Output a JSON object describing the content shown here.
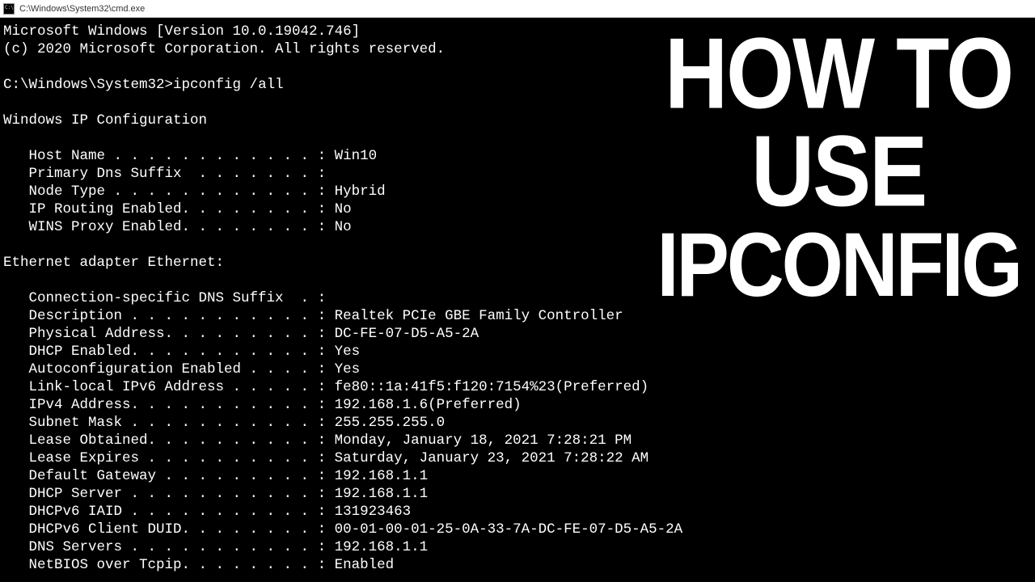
{
  "titlebar": {
    "path": "C:\\Windows\\System32\\cmd.exe"
  },
  "header": {
    "version_line": "Microsoft Windows [Version 10.0.19042.746]",
    "copyright_line": "(c) 2020 Microsoft Corporation. All rights reserved."
  },
  "prompt": {
    "path": "C:\\Windows\\System32>",
    "command": "ipconfig /all"
  },
  "ipconfig": {
    "heading": "Windows IP Configuration",
    "host_name_label": "   Host Name . . . . . . . . . . . . : ",
    "host_name_value": "Win10",
    "primary_dns_label": "   Primary Dns Suffix  . . . . . . . :",
    "primary_dns_value": "",
    "node_type_label": "   Node Type . . . . . . . . . . . . : ",
    "node_type_value": "Hybrid",
    "ip_routing_label": "   IP Routing Enabled. . . . . . . . : ",
    "ip_routing_value": "No",
    "wins_proxy_label": "   WINS Proxy Enabled. . . . . . . . : ",
    "wins_proxy_value": "No"
  },
  "adapter": {
    "heading": "Ethernet adapter Ethernet:",
    "conn_dns_label": "   Connection-specific DNS Suffix  . :",
    "conn_dns_value": "",
    "description_label": "   Description . . . . . . . . . . . : ",
    "description_value": "Realtek PCIe GBE Family Controller",
    "physical_label": "   Physical Address. . . . . . . . . : ",
    "physical_value": "DC-FE-07-D5-A5-2A",
    "dhcp_enabled_label": "   DHCP Enabled. . . . . . . . . . . : ",
    "dhcp_enabled_value": "Yes",
    "autoconfig_label": "   Autoconfiguration Enabled . . . . : ",
    "autoconfig_value": "Yes",
    "link_local_label": "   Link-local IPv6 Address . . . . . : ",
    "link_local_value": "fe80::1a:41f5:f120:7154%23(Preferred)",
    "ipv4_label": "   IPv4 Address. . . . . . . . . . . : ",
    "ipv4_value": "192.168.1.6(Preferred)",
    "subnet_label": "   Subnet Mask . . . . . . . . . . . : ",
    "subnet_value": "255.255.255.0",
    "lease_obt_label": "   Lease Obtained. . . . . . . . . . : ",
    "lease_obt_value": "Monday, January 18, 2021 7:28:21 PM",
    "lease_exp_label": "   Lease Expires . . . . . . . . . . : ",
    "lease_exp_value": "Saturday, January 23, 2021 7:28:22 AM",
    "gateway_label": "   Default Gateway . . . . . . . . . : ",
    "gateway_value": "192.168.1.1",
    "dhcp_server_label": "   DHCP Server . . . . . . . . . . . : ",
    "dhcp_server_value": "192.168.1.1",
    "dhcpv6_iaid_label": "   DHCPv6 IAID . . . . . . . . . . . : ",
    "dhcpv6_iaid_value": "131923463",
    "dhcpv6_duid_label": "   DHCPv6 Client DUID. . . . . . . . : ",
    "dhcpv6_duid_value": "00-01-00-01-25-0A-33-7A-DC-FE-07-D5-A5-2A",
    "dns_servers_label": "   DNS Servers . . . . . . . . . . . : ",
    "dns_servers_value": "192.168.1.1",
    "netbios_label": "   NetBIOS over Tcpip. . . . . . . . : ",
    "netbios_value": "Enabled"
  },
  "overlay": {
    "line1": "HOW TO",
    "line2": "USE",
    "line3": "IPCONFIG"
  }
}
